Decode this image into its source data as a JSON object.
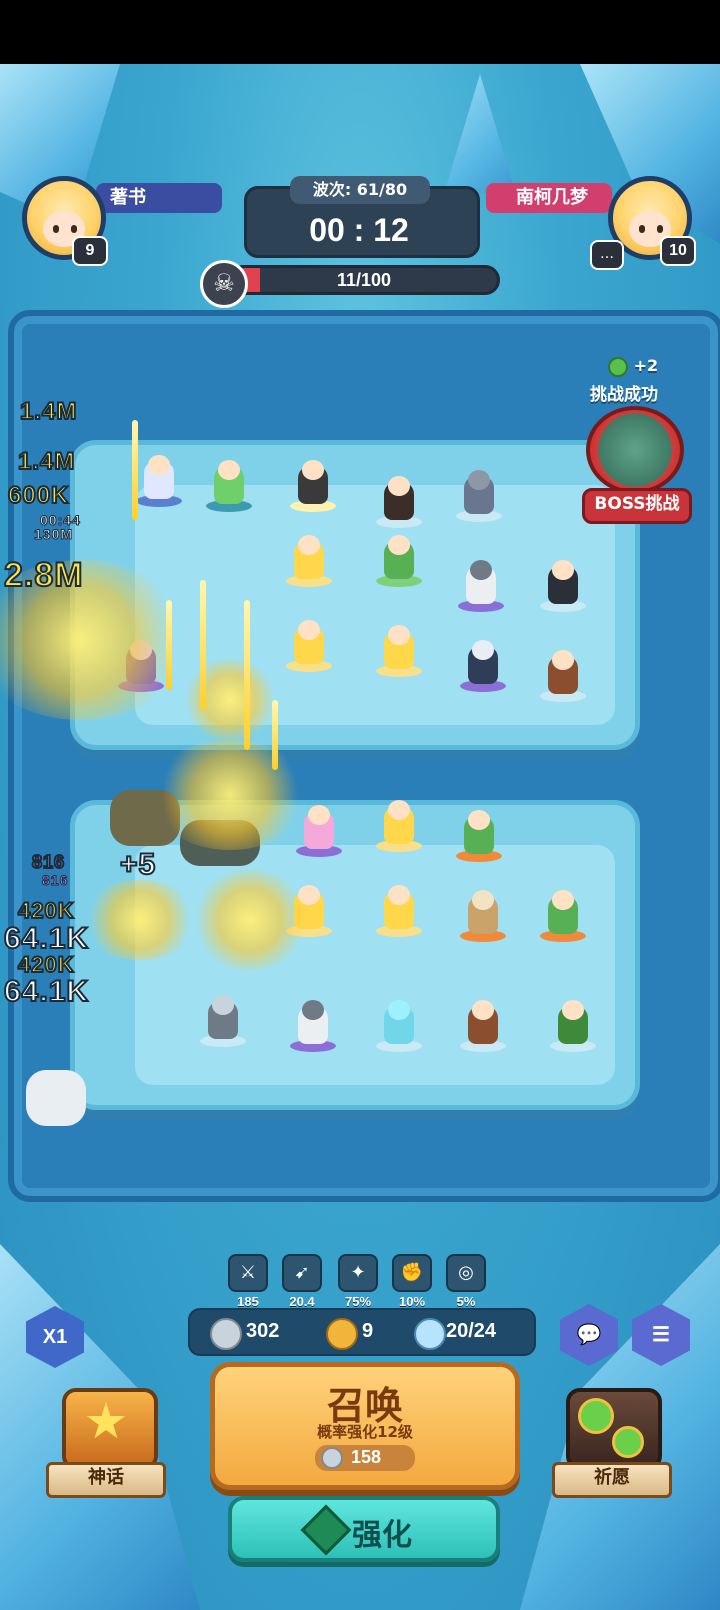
{
  "players": {
    "left": {
      "name": "著书",
      "level": "9"
    },
    "right": {
      "name": "南柯几梦",
      "level": "10"
    }
  },
  "wave": {
    "label": "波次: 61/80",
    "timer": "00 : 12"
  },
  "enemy_progress": {
    "text": "11/100",
    "fraction": 0.11
  },
  "boss": {
    "reward": "+2",
    "status": "挑战成功",
    "button": "BOSS挑战"
  },
  "damage_numbers": {
    "d1": "1.4M",
    "d2": "1.4M",
    "d3": "600K",
    "d4": "130M",
    "d5": "2.8M",
    "d6": "00:44",
    "d7": "816",
    "d8": "816",
    "d9": "+5",
    "d10": "420K",
    "d11": "64.1K",
    "d12": "420K",
    "d13": "64.1K"
  },
  "stats": [
    {
      "icon": "attack-icon",
      "value": "185"
    },
    {
      "icon": "speed-icon",
      "value": "20.4"
    },
    {
      "icon": "crit-icon",
      "value": "75%"
    },
    {
      "icon": "power-icon",
      "value": "10%"
    },
    {
      "icon": "skill-icon",
      "value": "5%"
    }
  ],
  "resources": {
    "silver": "302",
    "clover": "9",
    "units": "20/24"
  },
  "speed_button": "X1",
  "summon": {
    "title": "召唤",
    "subtitle": "概率强化12级",
    "cost": "158"
  },
  "enhance": {
    "label": "强化"
  },
  "side": {
    "myth": "神话",
    "wish": "祈愿"
  },
  "colors": {
    "accent_orange": "#f3a93f",
    "accent_teal": "#2ec0b8",
    "boss_red": "#c8343a",
    "bg_blue": "#3aa6cf"
  }
}
